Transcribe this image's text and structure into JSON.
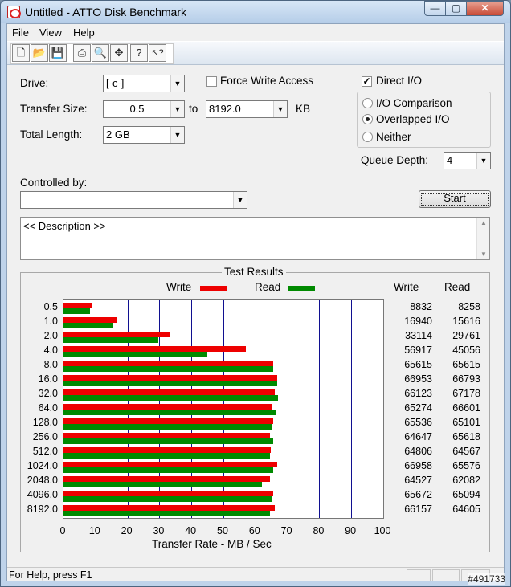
{
  "window": {
    "title": "Untitled - ATTO Disk Benchmark",
    "min_glyph": "—",
    "max_glyph": "▢",
    "close_glyph": "✕"
  },
  "menu": [
    {
      "label": "File"
    },
    {
      "label": "View"
    },
    {
      "label": "Help"
    }
  ],
  "toolbar": {
    "buttons": [
      {
        "icon": "new-document-icon",
        "glyph": "🗋"
      },
      {
        "icon": "open-folder-icon",
        "glyph": "📂"
      },
      {
        "icon": "save-icon",
        "glyph": "💾"
      },
      {
        "icon": "print-icon",
        "glyph": "⎙"
      },
      {
        "icon": "print-preview-icon",
        "glyph": "🔍"
      },
      {
        "icon": "move-icon",
        "glyph": "✥"
      },
      {
        "icon": "about-icon",
        "glyph": "?"
      },
      {
        "icon": "context-help-icon",
        "glyph": "↖?"
      }
    ]
  },
  "form": {
    "drive_label": "Drive:",
    "drive_value": "[-c-]",
    "force_write_label": "Force Write Access",
    "force_write_checked": false,
    "direct_io_label": "Direct I/O",
    "direct_io_checked": true,
    "transfer_size_label": "Transfer Size:",
    "transfer_from": "0.5",
    "to_label": "to",
    "transfer_to": "8192.0",
    "kb_label": "KB",
    "total_length_label": "Total Length:",
    "total_length_value": "2 GB",
    "io_comparison_label": "I/O Comparison",
    "overlapped_io_label": "Overlapped I/O",
    "neither_label": "Neither",
    "io_mode_selected": "overlapped",
    "queue_depth_label": "Queue Depth:",
    "queue_depth_value": "4",
    "controlled_by_label": "Controlled by:",
    "controlled_by_value": "",
    "start_label": "Start",
    "description": "<< Description >>"
  },
  "results": {
    "title": "Test Results",
    "write_label": "Write",
    "read_label": "Read",
    "write_color": "#ee0000",
    "read_color": "#008a00",
    "write_col_header": "Write",
    "read_col_header": "Read"
  },
  "chart_data": {
    "type": "bar",
    "orientation": "horizontal",
    "xlabel": "Transfer Rate - MB / Sec",
    "xlim": [
      0,
      100
    ],
    "xticks": [
      0,
      10,
      20,
      30,
      40,
      50,
      60,
      70,
      80,
      90,
      100
    ],
    "categories": [
      "0.5",
      "1.0",
      "2.0",
      "4.0",
      "8.0",
      "16.0",
      "32.0",
      "64.0",
      "128.0",
      "256.0",
      "512.0",
      "1024.0",
      "2048.0",
      "4096.0",
      "8192.0"
    ],
    "series": [
      {
        "name": "Write",
        "values": [
          8.832,
          16.94,
          33.114,
          56.917,
          65.615,
          66.953,
          66.123,
          65.274,
          65.536,
          64.647,
          64.806,
          66.958,
          64.527,
          65.672,
          66.157
        ]
      },
      {
        "name": "Read",
        "values": [
          8.258,
          15.616,
          29.761,
          45.056,
          65.615,
          66.793,
          67.178,
          66.601,
          65.101,
          65.618,
          64.567,
          65.576,
          62.082,
          65.094,
          64.605
        ]
      }
    ],
    "write_kbps": [
      "8832",
      "16940",
      "33114",
      "56917",
      "65615",
      "66953",
      "66123",
      "65274",
      "65536",
      "64647",
      "64806",
      "66958",
      "64527",
      "65672",
      "66157"
    ],
    "read_kbps": [
      "8258",
      "15616",
      "29761",
      "45056",
      "65615",
      "66793",
      "67178",
      "66601",
      "65101",
      "65618",
      "64567",
      "65576",
      "62082",
      "65094",
      "64605"
    ],
    "legend": "top"
  },
  "status": {
    "text": "For Help, press F1",
    "watermark": "#491733"
  }
}
